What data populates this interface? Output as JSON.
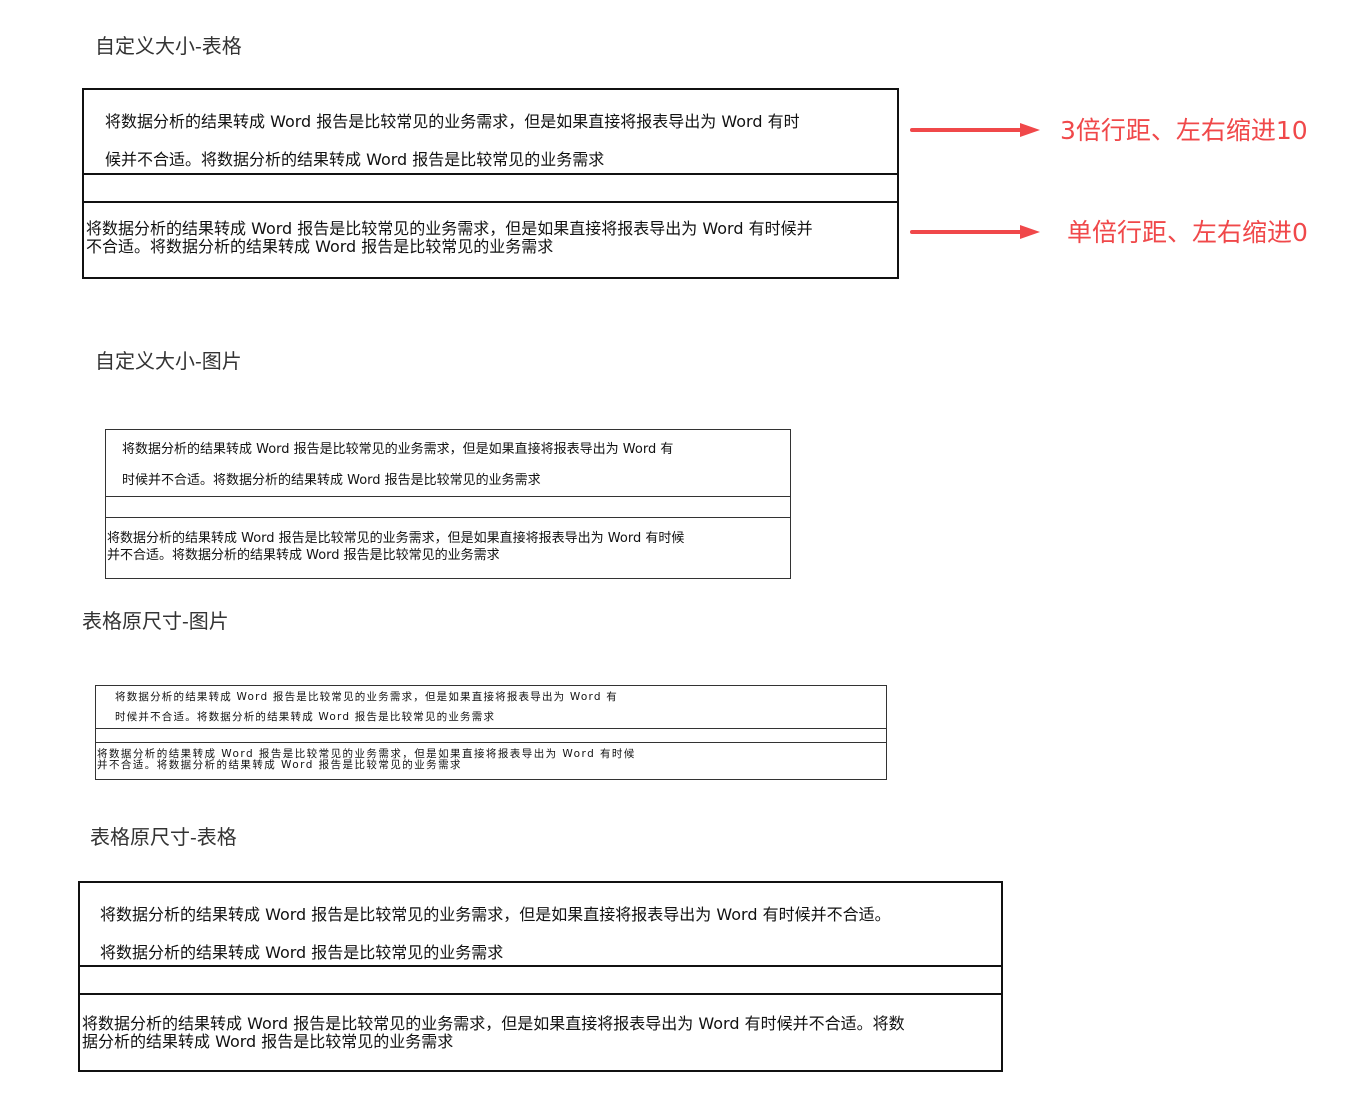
{
  "sections": [
    {
      "heading": "自定义大小-表格",
      "row1_line1": "将数据分析的结果转成 Word 报告是比较常见的业务需求，但是如果直接将报表导出为 Word 有时",
      "row1_line2": "候并不合适。将数据分析的结果转成 Word 报告是比较常见的业务需求",
      "row3_line1": "将数据分析的结果转成 Word 报告是比较常见的业务需求，但是如果直接将报表导出为 Word 有时候并",
      "row3_line2": "不合适。将数据分析的结果转成 Word 报告是比较常见的业务需求"
    },
    {
      "heading": "自定义大小-图片",
      "row1_line1": "将数据分析的结果转成 Word 报告是比较常见的业务需求，但是如果直接将报表导出为 Word 有",
      "row1_line2": "时候并不合适。将数据分析的结果转成 Word 报告是比较常见的业务需求",
      "row3_line1": "将数据分析的结果转成 Word 报告是比较常见的业务需求，但是如果直接将报表导出为 Word 有时候",
      "row3_line2": "并不合适。将数据分析的结果转成 Word 报告是比较常见的业务需求"
    },
    {
      "heading": "表格原尺寸-图片",
      "row1_line1": "将数据分析的结果转成 Word 报告是比较常见的业务需求，但是如果直接将报表导出为 Word 有",
      "row1_line2": "时候并不合适。将数据分析的结果转成 Word 报告是比较常见的业务需求",
      "row3_line1": "将数据分析的结果转成 Word 报告是比较常见的业务需求，但是如果直接将报表导出为 Word 有时候",
      "row3_line2": "并不合适。将数据分析的结果转成 Word 报告是比较常见的业务需求"
    },
    {
      "heading": "表格原尺寸-表格",
      "row1_line1": "将数据分析的结果转成 Word 报告是比较常见的业务需求，但是如果直接将报表导出为 Word 有时候并不合适。",
      "row1_line2": "将数据分析的结果转成 Word 报告是比较常见的业务需求",
      "row3_line1": "将数据分析的结果转成 Word 报告是比较常见的业务需求，但是如果直接将报表导出为 Word 有时候并不合适。将数",
      "row3_line2": "据分析的结果转成 Word 报告是比较常见的业务需求"
    }
  ],
  "annotations": [
    {
      "text": "3倍行距、左右缩进10",
      "icon": "arrow-right-icon"
    },
    {
      "text": "单倍行距、左右缩进0",
      "icon": "arrow-right-icon"
    }
  ],
  "colors": {
    "annotation": "#f0484a",
    "border": "#111111"
  }
}
